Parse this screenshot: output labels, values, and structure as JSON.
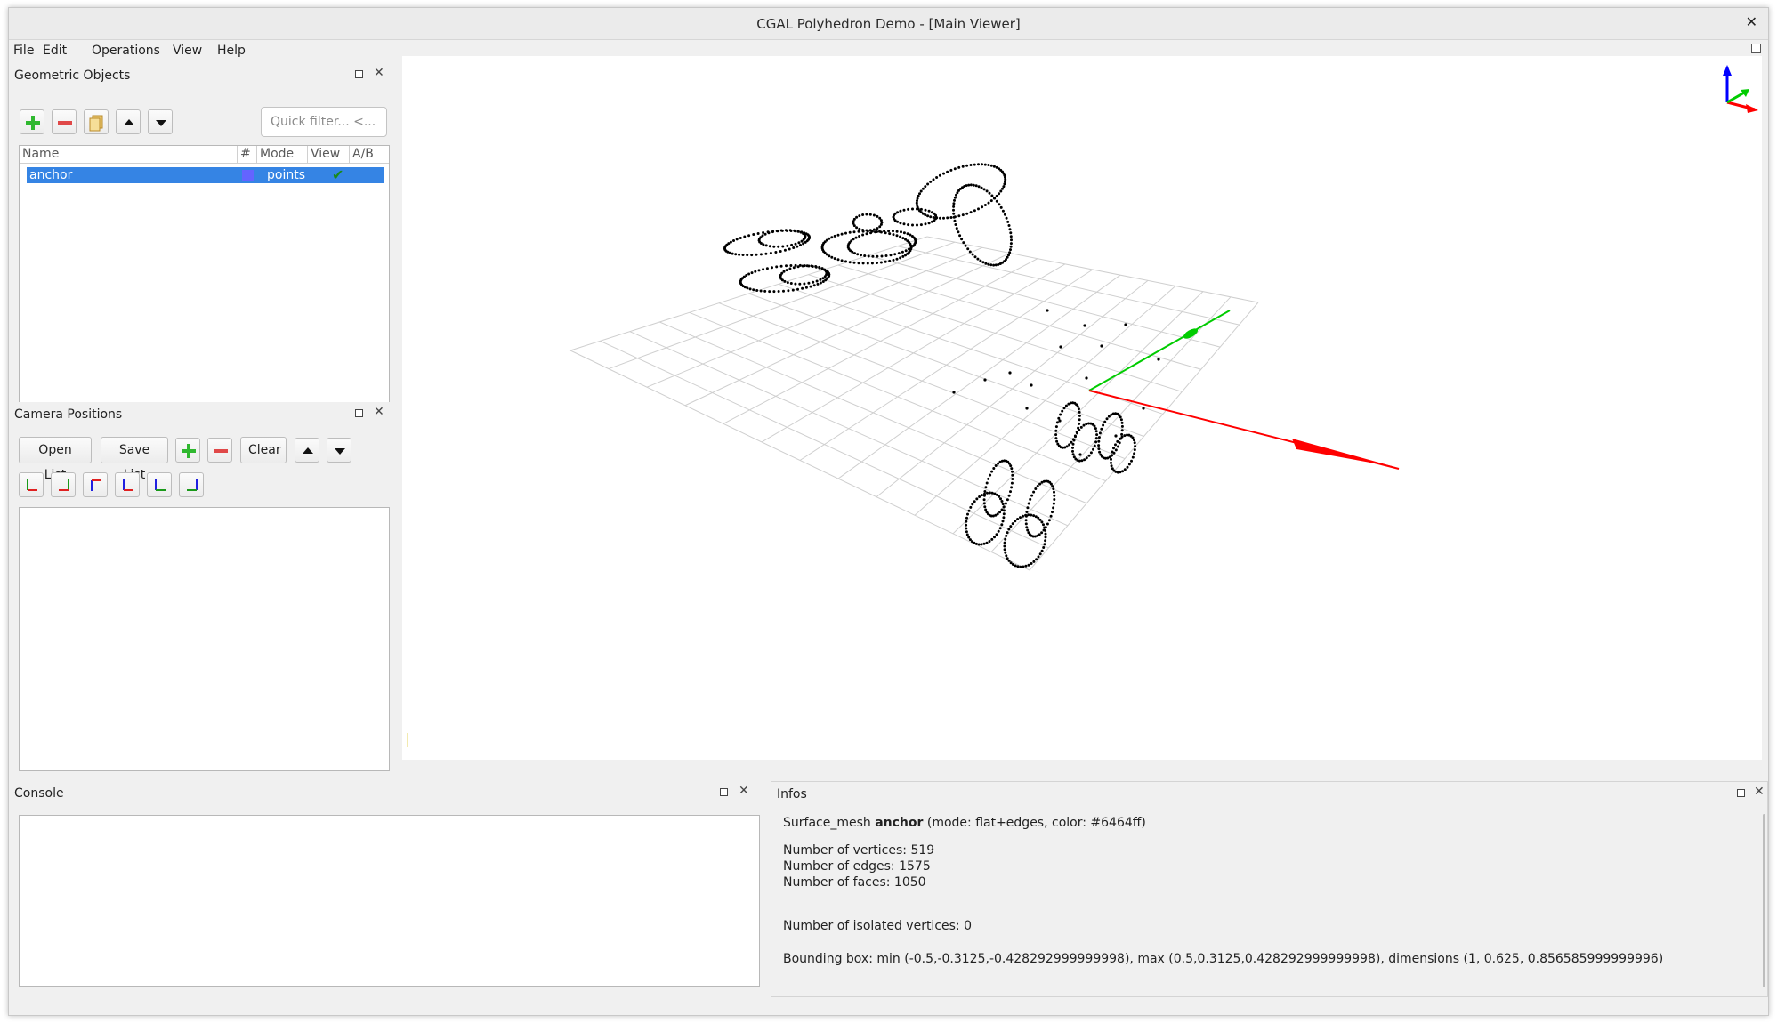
{
  "window": {
    "title": "CGAL Polyhedron Demo - [Main Viewer]",
    "close_symbol": "✕"
  },
  "menu": [
    "File",
    "Edit",
    "Operations",
    "View",
    "Help"
  ],
  "geometric_objects": {
    "title": "Geometric Objects",
    "toolbar_icons": [
      "add-icon",
      "remove-icon",
      "duplicate-icon",
      "arrow-up-icon",
      "arrow-down-icon"
    ],
    "filter_placeholder": "Quick filter... <...",
    "columns": [
      "Name",
      "#",
      "Mode",
      "View",
      "A/B"
    ],
    "rows": [
      {
        "name": "anchor",
        "color": "#6464ff",
        "mode": "points",
        "view": "✔",
        "ab": ""
      }
    ]
  },
  "camera_positions": {
    "title": "Camera Positions",
    "buttons": {
      "open": "Open List",
      "save": "Save List",
      "clear": "Clear"
    },
    "view_icons": [
      "front-view-icon",
      "back-view-icon",
      "top-view-icon",
      "bottom-view-icon",
      "left-view-icon",
      "right-view-icon"
    ]
  },
  "console": {
    "title": "Console"
  },
  "infos": {
    "title": "Infos",
    "mesh_prefix": "Surface_mesh ",
    "mesh_name": "anchor",
    "mesh_suffix": " (mode: flat+edges, color: #6464ff)",
    "vertices": "Number of vertices: 519",
    "edges": "Number of edges: 1575",
    "faces": "Number of faces: 1050",
    "isolated": "Number of isolated vertices: 0",
    "bbox": "Bounding box: min (-0.5,-0.3125,-0.428292999999998), max (0.5,0.3125,0.428292999999998), dimensions (1, 0.625, 0.856585999999996)"
  },
  "colors": {
    "selection": "#3584e4",
    "axis_x": "#ff0000",
    "axis_y": "#00cc00",
    "axis_z": "#0000ff"
  }
}
